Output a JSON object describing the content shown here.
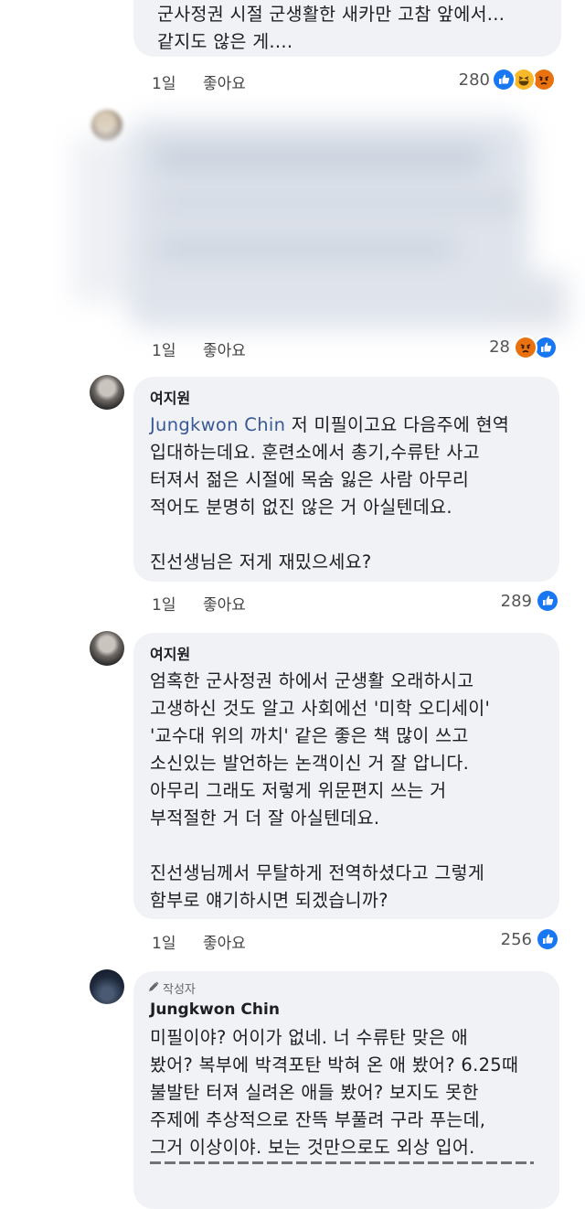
{
  "comments": [
    {
      "text": "군사정권 시절 군생활한 새카만 고참 앞에서...\n같지도 않은 게....",
      "time": "1일",
      "like_label": "좋아요",
      "count": "280",
      "reactions": [
        "like",
        "haha",
        "angry"
      ]
    },
    {
      "time": "1일",
      "like_label": "좋아요",
      "count": "28",
      "reactions": [
        "angry",
        "like"
      ]
    },
    {
      "author": "여지원",
      "mention": "Jungkwon Chin",
      "text_after_mention": " 저 미필이고요 다음주에 현역\n입대하는데요. 훈련소에서 총기,수류탄 사고\n터져서 젊은 시절에 목숨 잃은 사람 아무리\n적어도 분명히 없진 않은 거 아실텐데요.\n\n진선생님은 저게 재밌으세요?",
      "time": "1일",
      "like_label": "좋아요",
      "count": "289",
      "reactions": [
        "like"
      ]
    },
    {
      "author": "여지원",
      "text": "엄혹한 군사정권 하에서 군생활 오래하시고\n고생하신 것도 알고 사회에선 '미학 오디세이'\n'교수대 위의 까치' 같은 좋은 책 많이 쓰고\n소신있는 발언하는 논객이신 거 잘 압니다.\n아무리 그래도 저렇게 위문편지 쓰는 거\n부적절한 거 더 잘 아실텐데요.\n\n진선생님께서 무탈하게 전역하셨다고 그렇게\n함부로 얘기하시면 되겠습니까?",
      "time": "1일",
      "like_label": "좋아요",
      "count": "256",
      "reactions": [
        "like"
      ]
    },
    {
      "badge": "작성자",
      "author": "Jungkwon Chin",
      "text": "미필이야? 어이가 없네. 너 수류탄 맞은 애\n봤어? 복부에 박격포탄 박혀 온 애 봤어? 6.25때\n불발탄 터져 실려온 애들 봤어? 보지도 못한\n주제에 추상적으로 잔뜩 부풀려 구라 푸는데,\n그거 이상이야. 보는 것만으로도 외상 입어."
    }
  ],
  "colors": {
    "bubble": "#f0f2f5",
    "like_blue": "#1877f2",
    "haha_yellow": "#f7b928",
    "angry_orange": "#e9710f",
    "mention": "#385898"
  }
}
